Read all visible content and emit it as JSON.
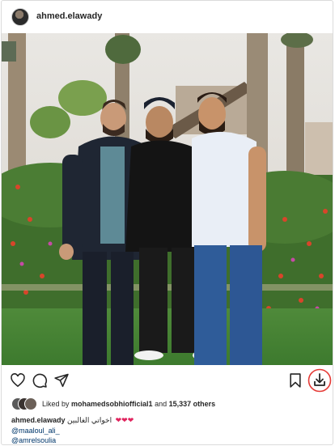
{
  "post": {
    "author": "ahmed.elawady",
    "likes": {
      "prefix": "Liked by",
      "user": "mohamedsobhiofficial1",
      "middle": "and",
      "count_text": "15,337 others"
    },
    "caption": {
      "username": "ahmed.elawady",
      "text": "اخواتي الغالبين",
      "hearts": "❤❤❤"
    },
    "mentions": [
      "@maaloul_ali_",
      "@amrelsoulia"
    ]
  },
  "icons": {
    "like": "heart-outline-icon",
    "comment": "comment-bubble-icon",
    "share": "paper-plane-icon",
    "save": "bookmark-icon",
    "download": "download-icon"
  },
  "colors": {
    "text": "#262626",
    "mention": "#00376b",
    "heart": "#e0245e",
    "download_ring": "#e53935"
  }
}
